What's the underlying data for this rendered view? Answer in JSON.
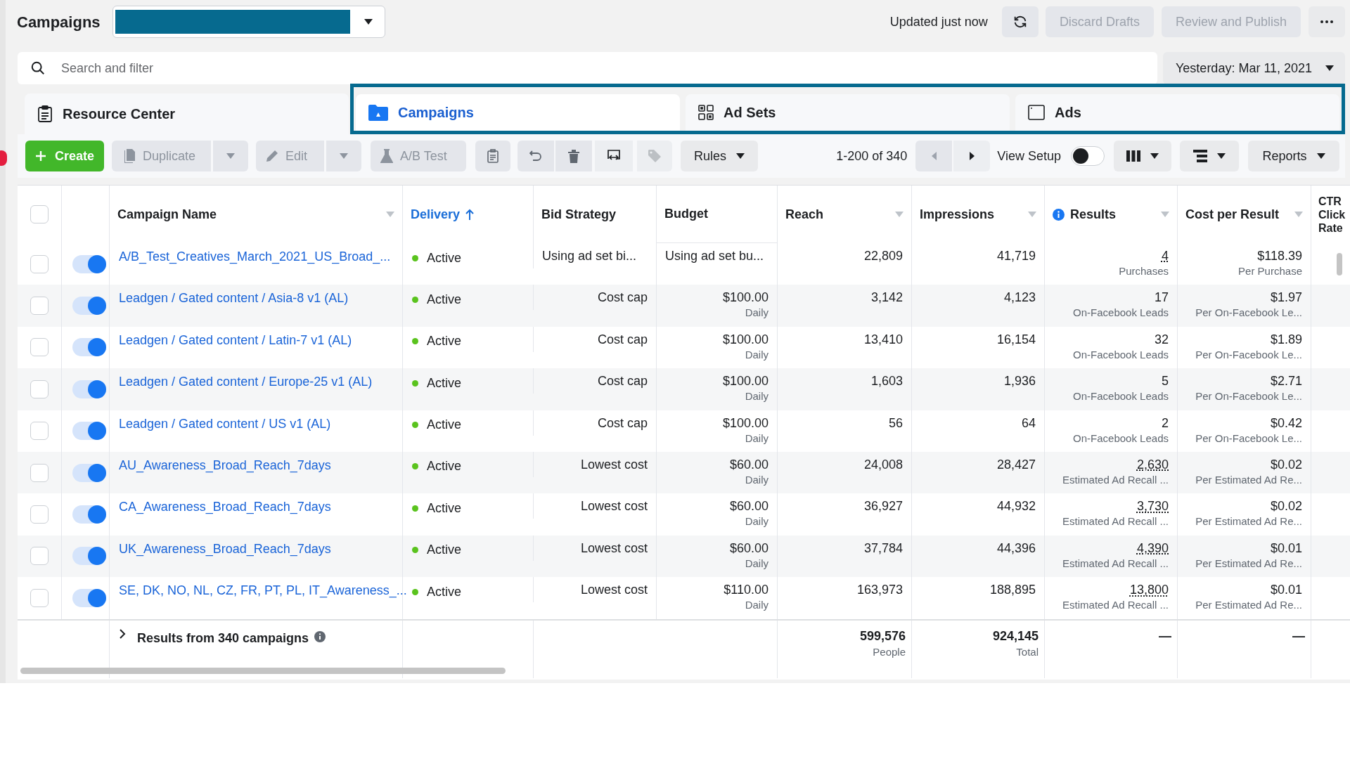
{
  "header": {
    "title": "Campaigns",
    "updated": "Updated just now",
    "buttons": [
      {
        "label": "Discard Drafts",
        "disabled": true
      },
      {
        "label": "Review and Publish",
        "disabled": true
      }
    ]
  },
  "search": {
    "placeholder": "Search and filter"
  },
  "date_range": "Yesterday: Mar 11, 2021",
  "resource_center": "Resource Center",
  "level_tabs": [
    {
      "label": "Campaigns",
      "selected": true
    },
    {
      "label": "Ad Sets",
      "selected": false
    },
    {
      "label": "Ads",
      "selected": false
    }
  ],
  "toolbar": {
    "create": "Create",
    "duplicate": "Duplicate",
    "edit": "Edit",
    "ab_test": "A/B Test",
    "rules": "Rules",
    "pagination": "1-200 of 340",
    "view_setup": {
      "label": "View Setup",
      "on": false
    },
    "reports": "Reports"
  },
  "table": {
    "select_all": {
      "checked": false
    },
    "columns": [
      {
        "label": "Campaign Name",
        "sorted": false,
        "info": false,
        "menu": true
      },
      {
        "label": "Delivery",
        "sorted": true,
        "info": false,
        "menu": false
      },
      {
        "label": "Bid Strategy",
        "sorted": false,
        "info": false,
        "menu": false
      },
      {
        "label": "Budget",
        "sorted": false,
        "info": false,
        "menu": false
      },
      {
        "label": "Reach",
        "sorted": false,
        "info": false,
        "menu": true
      },
      {
        "label": "Impressions",
        "sorted": false,
        "info": false,
        "menu": true
      },
      {
        "label": "Results",
        "sorted": false,
        "info": true,
        "menu": true
      },
      {
        "label": "Cost per Result",
        "sorted": false,
        "info": false,
        "menu": true
      },
      {
        "label": "CTR Click Rate",
        "sorted": false,
        "info": false,
        "menu": false
      }
    ],
    "rows": [
      {
        "checked": false,
        "on": true,
        "name": "A/B_Test_Creatives_March_2021_US_Broad_...",
        "delivery": "Active",
        "bid": "Using ad set bi...",
        "budget": "Using ad set bu...",
        "reach": "22,809",
        "impressions": "41,719",
        "result": "4",
        "result_dotted": true,
        "result_type": "Purchases",
        "cost": "$118.39",
        "cost_type": "Per Purchase"
      },
      {
        "checked": false,
        "on": true,
        "name": "Leadgen / Gated content / Asia-8 v1 (AL)",
        "delivery": "Active",
        "bid": "Cost cap",
        "budget": "$100.00",
        "budget_period": "Daily",
        "reach": "3,142",
        "impressions": "4,123",
        "result": "17",
        "result_dotted": false,
        "result_type": "On-Facebook Leads",
        "cost": "$1.97",
        "cost_type": "Per On-Facebook Le..."
      },
      {
        "checked": false,
        "on": true,
        "name": "Leadgen / Gated content / Latin-7 v1 (AL)",
        "delivery": "Active",
        "bid": "Cost cap",
        "budget": "$100.00",
        "budget_period": "Daily",
        "reach": "13,410",
        "impressions": "16,154",
        "result": "32",
        "result_dotted": false,
        "result_type": "On-Facebook Leads",
        "cost": "$1.89",
        "cost_type": "Per On-Facebook Le..."
      },
      {
        "checked": false,
        "on": true,
        "name": "Leadgen / Gated content / Europe-25 v1 (AL)",
        "delivery": "Active",
        "bid": "Cost cap",
        "budget": "$100.00",
        "budget_period": "Daily",
        "reach": "1,603",
        "impressions": "1,936",
        "result": "5",
        "result_dotted": false,
        "result_type": "On-Facebook Leads",
        "cost": "$2.71",
        "cost_type": "Per On-Facebook Le..."
      },
      {
        "checked": false,
        "on": true,
        "name": "Leadgen / Gated content / US v1 (AL)",
        "delivery": "Active",
        "bid": "Cost cap",
        "budget": "$100.00",
        "budget_period": "Daily",
        "reach": "56",
        "impressions": "64",
        "result": "2",
        "result_dotted": false,
        "result_type": "On-Facebook Leads",
        "cost": "$0.42",
        "cost_type": "Per On-Facebook Le..."
      },
      {
        "checked": false,
        "on": true,
        "name": "AU_Awareness_Broad_Reach_7days",
        "delivery": "Active",
        "bid": "Lowest cost",
        "budget": "$60.00",
        "budget_period": "Daily",
        "reach": "24,008",
        "impressions": "28,427",
        "result": "2,630",
        "result_dotted": true,
        "result_type": "Estimated Ad Recall ...",
        "cost": "$0.02",
        "cost_type": "Per Estimated Ad Re..."
      },
      {
        "checked": false,
        "on": true,
        "name": "CA_Awareness_Broad_Reach_7days",
        "delivery": "Active",
        "bid": "Lowest cost",
        "budget": "$60.00",
        "budget_period": "Daily",
        "reach": "36,927",
        "impressions": "44,932",
        "result": "3,730",
        "result_dotted": true,
        "result_type": "Estimated Ad Recall ...",
        "cost": "$0.02",
        "cost_type": "Per Estimated Ad Re..."
      },
      {
        "checked": false,
        "on": true,
        "name": "UK_Awareness_Broad_Reach_7days",
        "delivery": "Active",
        "bid": "Lowest cost",
        "budget": "$60.00",
        "budget_period": "Daily",
        "reach": "37,784",
        "impressions": "44,396",
        "result": "4,390",
        "result_dotted": true,
        "result_type": "Estimated Ad Recall ...",
        "cost": "$0.01",
        "cost_type": "Per Estimated Ad Re..."
      },
      {
        "checked": false,
        "on": true,
        "name": "SE, DK, NO, NL, CZ, FR, PT, PL, IT_Awareness_...",
        "delivery": "Active",
        "bid": "Lowest cost",
        "budget": "$110.00",
        "budget_period": "Daily",
        "reach": "163,973",
        "impressions": "188,895",
        "result": "13,800",
        "result_dotted": true,
        "result_type": "Estimated Ad Recall ...",
        "cost": "$0.01",
        "cost_type": "Per Estimated Ad Re..."
      }
    ],
    "footer": {
      "label": "Results from 340 campaigns",
      "reach": "599,576",
      "reach_caption": "People",
      "impressions": "924,145",
      "impressions_caption": "Total",
      "results": "—",
      "cost": "—"
    }
  }
}
